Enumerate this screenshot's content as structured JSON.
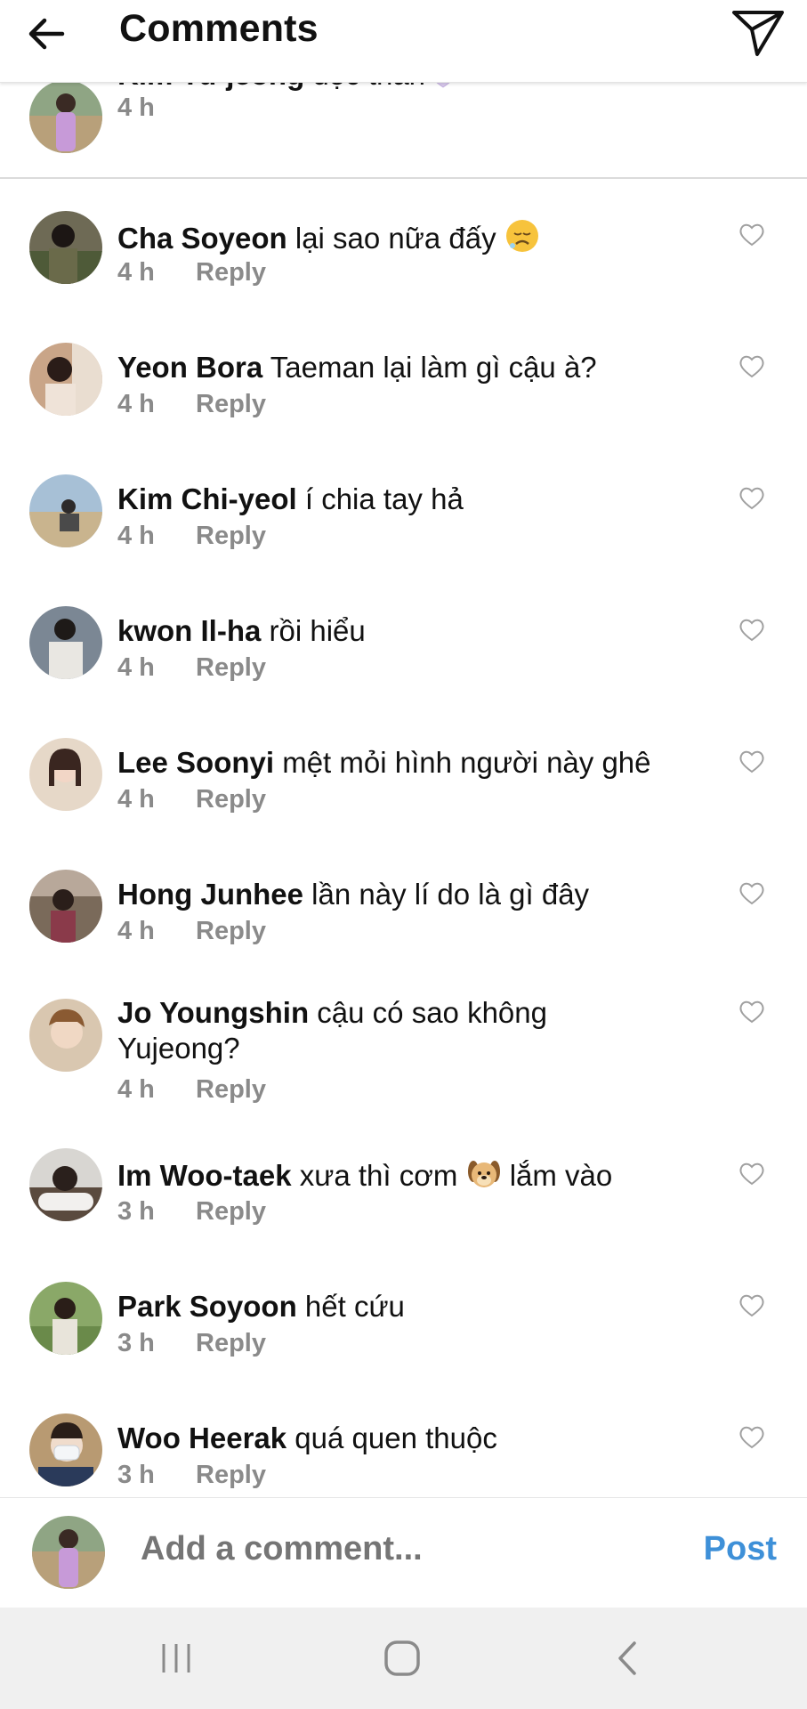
{
  "header": {
    "title": "Comments"
  },
  "caption": {
    "username": "Kim Yu-jeong",
    "text": " độc thân",
    "time": "4 h"
  },
  "reply_label": "Reply",
  "comments": [
    {
      "username": "Cha Soyeon",
      "text": " lại sao nữa đấy",
      "time": "4 h"
    },
    {
      "username": "Yeon Bora",
      "text": " Taeman lại làm gì cậu à?",
      "time": "4 h"
    },
    {
      "username": "Kim Chi-yeol",
      "text": " í chia tay hả",
      "time": "4 h"
    },
    {
      "username": "kwon Il-ha",
      "text": " rồi hiểu",
      "time": "4 h"
    },
    {
      "username": "Lee Soonyi",
      "text": " mệt mỏi hình người này ghê",
      "time": "4 h"
    },
    {
      "username": "Hong Junhee",
      "text": " lần này lí do là gì đây",
      "time": "4 h"
    },
    {
      "username": "Jo Youngshin",
      "text": " cậu có sao không Yujeong?",
      "time": "4 h"
    },
    {
      "username": "Im Woo-taek",
      "text_before": " xưa thì cơm ",
      "text_after": " lắm vào",
      "time": "3 h"
    },
    {
      "username": "Park Soyoon",
      "text": " hết cứu",
      "time": "3 h"
    },
    {
      "username": "Woo Heerak",
      "text": " quá quen thuộc",
      "time": "3 h"
    }
  ],
  "composer": {
    "placeholder": "Add a comment...",
    "post_label": "Post"
  },
  "icons": {
    "back": "arrow-left-icon",
    "share": "paper-plane-icon",
    "like": "heart-outline-icon",
    "emoji_caption": "purple-heart-emoji",
    "emoji_soyeon": "disappointed-face-emoji",
    "emoji_wootaek": "dog-face-emoji",
    "nav_recents": "recent-apps-icon",
    "nav_home": "home-icon",
    "nav_back": "nav-back-icon"
  },
  "colors": {
    "post": "#3e90d8",
    "meta": "#8a8a8a",
    "navbar": "#f0f0f0"
  }
}
